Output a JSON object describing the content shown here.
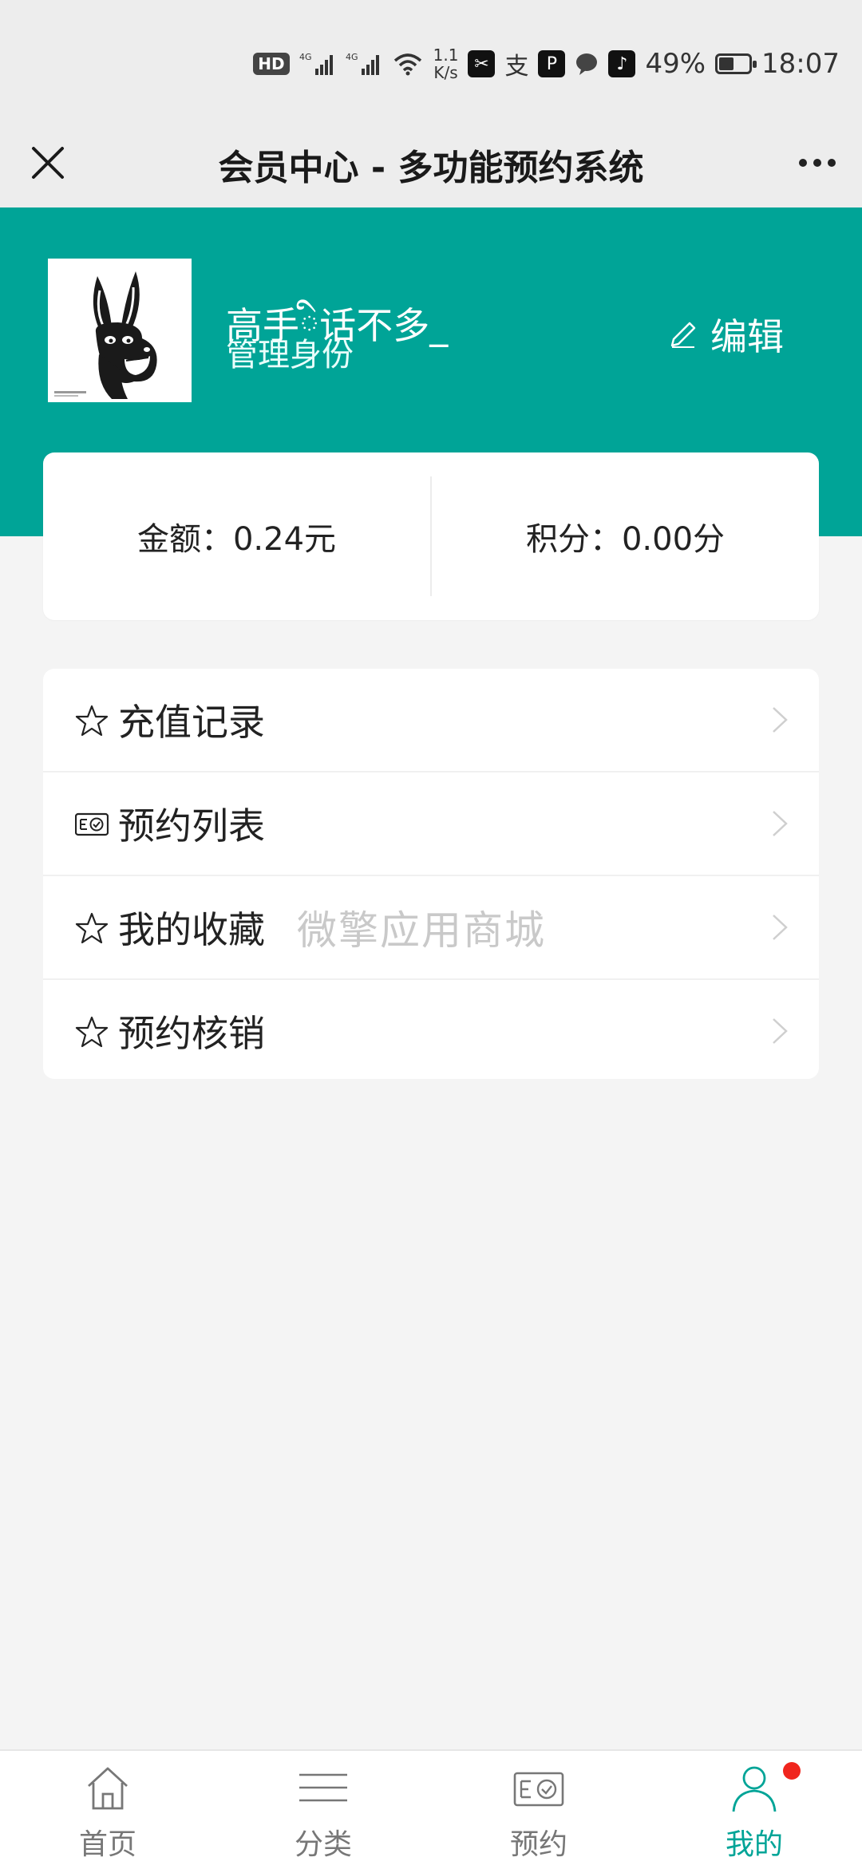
{
  "status_bar": {
    "hd": "HD",
    "signal_1": "4G",
    "signal_2": "4G",
    "net_speed_value": "1.1",
    "net_speed_unit": "K/s",
    "battery_percent": "49%",
    "battery_level": 0.49,
    "time": "18:07",
    "app_icons": [
      "capcut-icon",
      "alipay-icon",
      "pinduoduo-icon",
      "chat-bubble-icon",
      "tiktok-icon"
    ]
  },
  "title_bar": {
    "title": "会员中心 - 多功能预约系统"
  },
  "profile": {
    "name": "高手ི话不多_",
    "role": "管理身份",
    "edit_label": "编辑"
  },
  "stats": {
    "balance": "金额：0.24元",
    "points": "积分：0.00分"
  },
  "menu": {
    "items": [
      {
        "label": "充值记录",
        "icon": "star-icon"
      },
      {
        "label": "预约列表",
        "icon": "ticket-check-icon"
      },
      {
        "label": "我的收藏",
        "icon": "star-icon"
      },
      {
        "label": "预约核销",
        "icon": "star-icon"
      }
    ],
    "watermark": "微擎应用商城"
  },
  "bottom_nav": {
    "items": [
      {
        "label": "首页",
        "icon": "home-icon"
      },
      {
        "label": "分类",
        "icon": "menu-lines-icon"
      },
      {
        "label": "预约",
        "icon": "ticket-check-icon"
      },
      {
        "label": "我的",
        "icon": "user-icon",
        "active": true
      }
    ]
  },
  "colors": {
    "accent": "#00a497",
    "background": "#f4f4f4",
    "badge_red": "#f0251d"
  }
}
